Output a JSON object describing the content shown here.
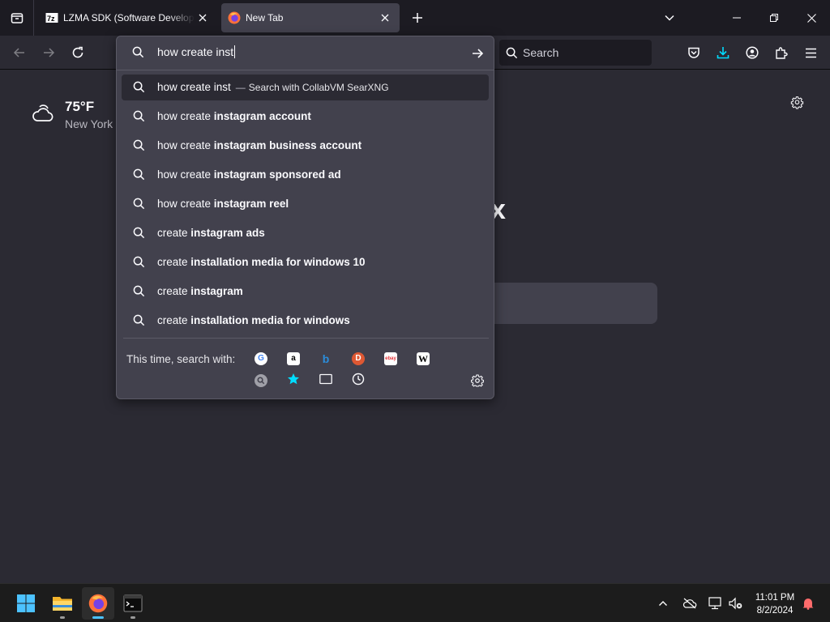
{
  "tabs": [
    {
      "title": "LZMA SDK (Software Development Kit)",
      "favicon": "7z-logo-icon"
    },
    {
      "title": "New Tab",
      "favicon": "firefox-icon"
    }
  ],
  "navbar": {
    "search_placeholder": "Search"
  },
  "newtab": {
    "weather_temp": "75°F",
    "weather_city": "New York",
    "brand_fragment": "x"
  },
  "urlbar": {
    "input_value": "how create inst",
    "results": [
      {
        "prefix": "how create inst",
        "bold": "",
        "action": "Search with CollabVM SearXNG",
        "selected": true
      },
      {
        "prefix": "how create ",
        "bold": "instagram account"
      },
      {
        "prefix": "how create ",
        "bold": "instagram business account"
      },
      {
        "prefix": "how create ",
        "bold": "instagram sponsored ad"
      },
      {
        "prefix": "how create ",
        "bold": "instagram reel"
      },
      {
        "prefix": "create ",
        "bold": "instagram ads"
      },
      {
        "prefix": "create ",
        "bold": "installation media for windows 10"
      },
      {
        "prefix": "create ",
        "bold": "instagram"
      },
      {
        "prefix": "create ",
        "bold": "installation media for windows"
      }
    ],
    "oneoff_label": "This time, search with:",
    "engines": [
      {
        "name": "google-icon",
        "glyph": "G",
        "color": "#4285f4",
        "bg": "#ffffff"
      },
      {
        "name": "amazon-icon",
        "glyph": "a",
        "color": "#000000",
        "bg": "#ffffff"
      },
      {
        "name": "bing-icon",
        "glyph": "b",
        "color": "#ffffff",
        "bg": "#2b8ddb"
      },
      {
        "name": "duckduckgo-icon",
        "glyph": "D",
        "color": "#ffffff",
        "bg": "#de5833"
      },
      {
        "name": "ebay-icon",
        "glyph": "ebay",
        "color": "#e53238",
        "bg": "#ffffff"
      },
      {
        "name": "wikipedia-icon",
        "glyph": "W",
        "color": "#000000",
        "bg": "#ffffff"
      },
      {
        "name": "searxng-icon",
        "glyph": "",
        "color": "#ffffff",
        "bg": "#a0a0a8"
      },
      {
        "name": "bookmarks-icon",
        "glyph": "",
        "color": "#00ddff",
        "bg": "transparent"
      },
      {
        "name": "tabs-icon",
        "glyph": "",
        "color": "#fbfbfe",
        "bg": "transparent"
      },
      {
        "name": "history-icon",
        "glyph": "",
        "color": "#fbfbfe",
        "bg": "transparent"
      }
    ]
  },
  "taskbar": {
    "apps": [
      "start-button",
      "file-explorer-icon",
      "firefox-icon",
      "terminal-icon"
    ],
    "time": "11:01 PM",
    "date": "8/2/2024"
  },
  "colors": {
    "accent": "#00ddff",
    "tab_bar": "#1c1b22",
    "toolbar": "#2b2a33",
    "popup": "#42414d",
    "download_accent": "#00ddff"
  }
}
